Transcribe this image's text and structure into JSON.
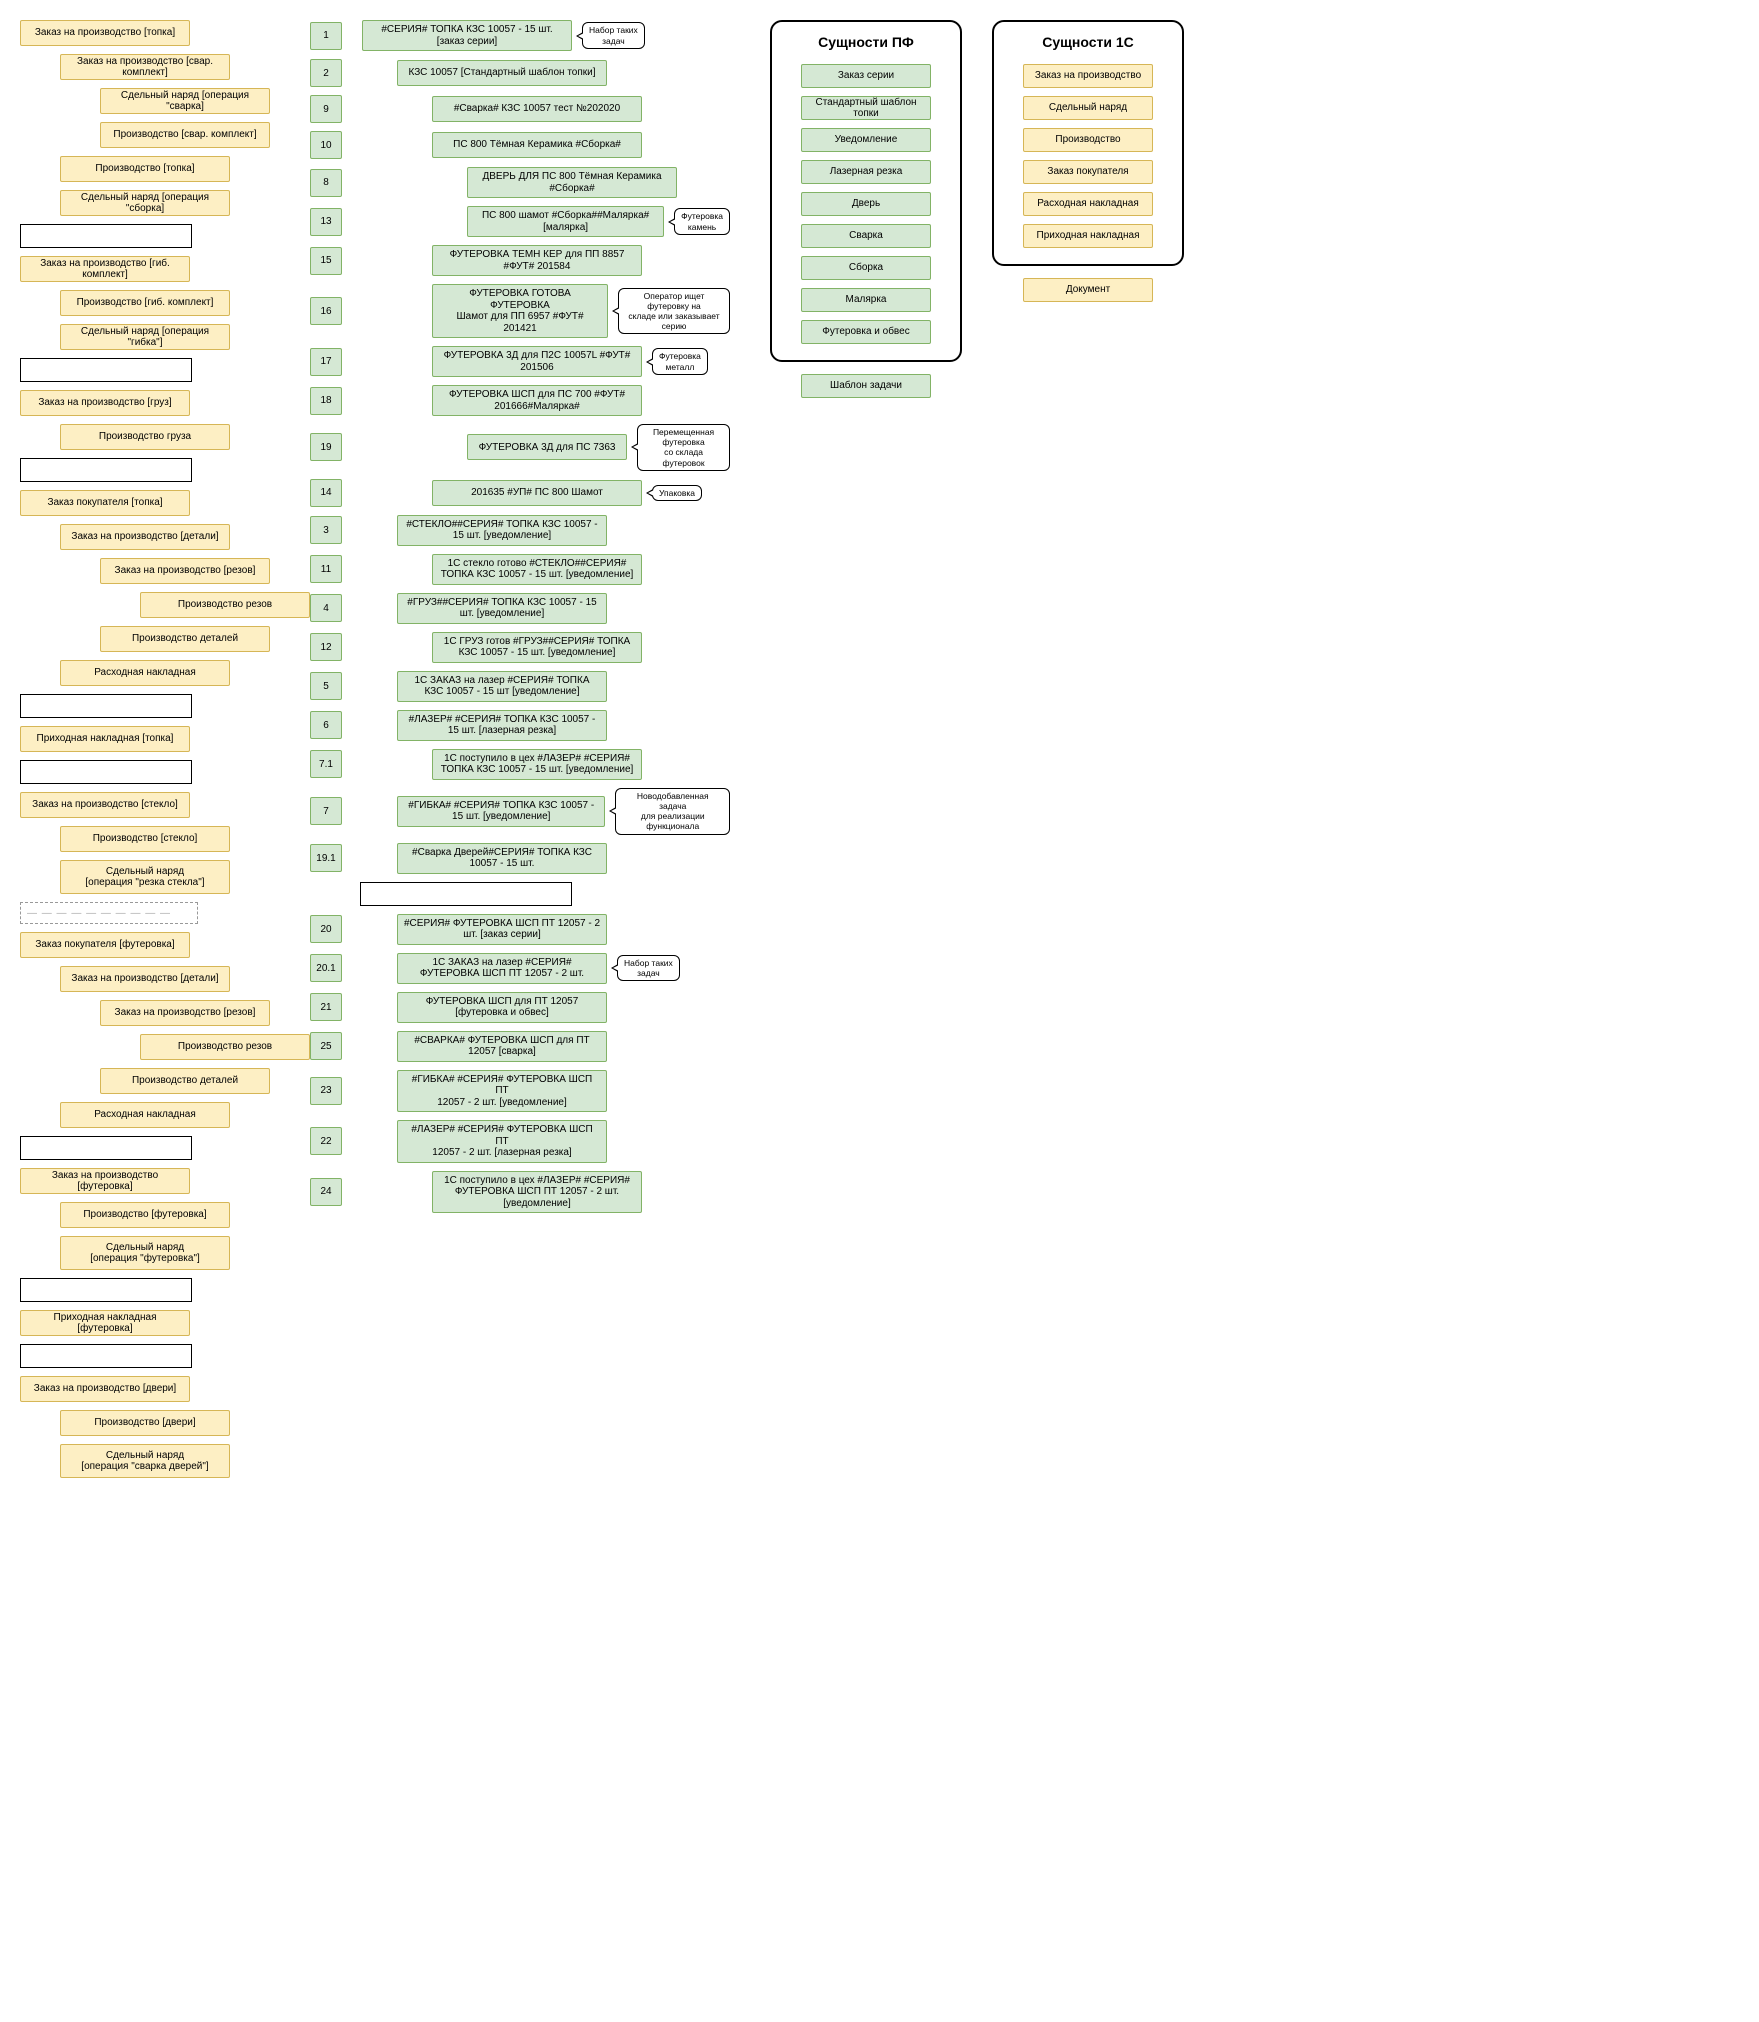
{
  "left_column": [
    {
      "type": "node",
      "style": "yellow",
      "indent": 0,
      "text": "Заказ на производство [топка]"
    },
    {
      "type": "node",
      "style": "yellow",
      "indent": 1,
      "text": "Заказ на производство [свар. комплект]"
    },
    {
      "type": "node",
      "style": "yellow",
      "indent": 2,
      "text": "Сдельный наряд [операция \"сварка]"
    },
    {
      "type": "node",
      "style": "yellow",
      "indent": 2,
      "text": "Производство [свар. комплект]"
    },
    {
      "type": "node",
      "style": "yellow",
      "indent": 1,
      "text": "Производство [топка]"
    },
    {
      "type": "node",
      "style": "yellow",
      "indent": 1,
      "text": "Сдельный наряд [операция \"сборка]"
    },
    {
      "type": "placeholder"
    },
    {
      "type": "node",
      "style": "yellow",
      "indent": 0,
      "text": "Заказ на производство [гиб. комплект]"
    },
    {
      "type": "node",
      "style": "yellow",
      "indent": 1,
      "text": "Производство [гиб. комплект]"
    },
    {
      "type": "node",
      "style": "yellow",
      "indent": 1,
      "text": "Сдельный наряд [операция \"гибка\"]"
    },
    {
      "type": "placeholder"
    },
    {
      "type": "node",
      "style": "yellow",
      "indent": 0,
      "text": "Заказ на производство [груз]"
    },
    {
      "type": "node",
      "style": "yellow",
      "indent": 1,
      "text": "Производство груза"
    },
    {
      "type": "placeholder"
    },
    {
      "type": "node",
      "style": "yellow",
      "indent": 0,
      "text": "Заказ покупателя [топка]"
    },
    {
      "type": "node",
      "style": "yellow",
      "indent": 1,
      "text": "Заказ на производство [детали]"
    },
    {
      "type": "node",
      "style": "yellow",
      "indent": 2,
      "text": "Заказ на производство [резов]"
    },
    {
      "type": "node",
      "style": "yellow",
      "indent": 3,
      "text": "Производство резов"
    },
    {
      "type": "node",
      "style": "yellow",
      "indent": 2,
      "text": "Производство деталей"
    },
    {
      "type": "node",
      "style": "yellow",
      "indent": 1,
      "text": "Расходная накладная"
    },
    {
      "type": "placeholder"
    },
    {
      "type": "node",
      "style": "yellow",
      "indent": 0,
      "text": "Приходная накладная [топка]"
    },
    {
      "type": "placeholder"
    },
    {
      "type": "node",
      "style": "yellow",
      "indent": 0,
      "text": "Заказ на производство [стекло]"
    },
    {
      "type": "node",
      "style": "yellow",
      "indent": 1,
      "text": "Производство [стекло]"
    },
    {
      "type": "node",
      "style": "yellow",
      "indent": 1,
      "tall": true,
      "text": "Сдельный наряд\n[операция \"резка стекла\"]"
    },
    {
      "type": "dashed"
    },
    {
      "type": "node",
      "style": "yellow",
      "indent": 0,
      "text": "Заказ покупателя [футеровка]"
    },
    {
      "type": "node",
      "style": "yellow",
      "indent": 1,
      "text": "Заказ на производство [детали]"
    },
    {
      "type": "node",
      "style": "yellow",
      "indent": 2,
      "text": "Заказ на производство [резов]"
    },
    {
      "type": "node",
      "style": "yellow",
      "indent": 3,
      "text": "Производство резов"
    },
    {
      "type": "node",
      "style": "yellow",
      "indent": 2,
      "text": "Производство деталей"
    },
    {
      "type": "node",
      "style": "yellow",
      "indent": 1,
      "text": "Расходная накладная"
    },
    {
      "type": "placeholder"
    },
    {
      "type": "node",
      "style": "yellow",
      "indent": 0,
      "text": "Заказ на производство [футеровка]"
    },
    {
      "type": "node",
      "style": "yellow",
      "indent": 1,
      "text": "Производство [футеровка]"
    },
    {
      "type": "node",
      "style": "yellow",
      "indent": 1,
      "tall": true,
      "text": "Сдельный наряд\n[операция \"футеровка\"]"
    },
    {
      "type": "placeholder"
    },
    {
      "type": "node",
      "style": "yellow",
      "indent": 0,
      "text": "Приходная накладная [футеровка]"
    },
    {
      "type": "placeholder"
    },
    {
      "type": "node",
      "style": "yellow",
      "indent": 0,
      "text": "Заказ на производство [двери]"
    },
    {
      "type": "node",
      "style": "yellow",
      "indent": 1,
      "text": "Производство [двери]"
    },
    {
      "type": "node",
      "style": "yellow",
      "indent": 1,
      "tall": true,
      "text": "Сдельный наряд\n[операция \"сварка дверей\"]"
    }
  ],
  "mid_column": [
    {
      "num": "1",
      "indent": 0,
      "text": "#СЕРИЯ# ТОПКА КЗС 10057 - 15 шт.\n[заказ серии]",
      "callout": "Набор таких\nзадач"
    },
    {
      "num": "2",
      "indent": 1,
      "text": "КЗС 10057  [Стандартный шаблон топки]"
    },
    {
      "num": "9",
      "indent": 2,
      "text": "#Сварка# КЗС 10057 тест №202020"
    },
    {
      "num": "10",
      "indent": 2,
      "text": "ПС 800 Тёмная Керамика #Сборка#"
    },
    {
      "num": "8",
      "indent": 3,
      "text": "ДВЕРЬ ДЛЯ ПС 800 Тёмная Керамика\n#Сборка#"
    },
    {
      "num": "13",
      "indent": 3,
      "text": "ПС 800 шамот #Сборка##Малярка#\n[малярка]",
      "callout": "Футеровка\nкамень"
    },
    {
      "num": "15",
      "indent": 2,
      "text": "ФУТЕРОВКА  ТЕМН КЕР для ПП 8857\n#ФУТ# 201584"
    },
    {
      "num": "16",
      "indent": 2,
      "text": "ФУТЕРОВКА ГОТОВА ФУТЕРОВКА\nШамот для ПП 6957 #ФУТ# 201421",
      "callout": "Оператор ищет футеровку на\nскладе или заказывает серию"
    },
    {
      "num": "17",
      "indent": 2,
      "text": "ФУТЕРОВКА 3Д для П2С 10057L #ФУТ#\n201506",
      "callout": "Футеровка\nметалл"
    },
    {
      "num": "18",
      "indent": 2,
      "text": "ФУТЕРОВКА ШСП для ПС 700 #ФУТ#\n201666#Малярка#"
    },
    {
      "num": "19",
      "indent": 3,
      "text": "ФУТЕРОВКА 3Д для ПС 7363",
      "callout": "Перемещенная футеровка\nсо склада футеровок"
    },
    {
      "num": "14",
      "indent": 2,
      "text": "201635 #УП# ПС 800 Шамот",
      "callout": "Упаковка"
    },
    {
      "num": "3",
      "indent": 1,
      "text": "#СТЕКЛО##СЕРИЯ# ТОПКА КЗС 10057 -\n15 шт. [уведомление]"
    },
    {
      "num": "11",
      "indent": 2,
      "text": "1С стекло готово #СТЕКЛО##СЕРИЯ#\nТОПКА КЗС 10057 - 15 шт. [уведомление]"
    },
    {
      "num": "4",
      "indent": 1,
      "text": "#ГРУЗ##СЕРИЯ# ТОПКА КЗС 10057 - 15\nшт. [уведомление]"
    },
    {
      "num": "12",
      "indent": 2,
      "text": "1С ГРУЗ готов #ГРУЗ##СЕРИЯ# ТОПКА\nКЗС 10057 - 15 шт. [уведомление]"
    },
    {
      "num": "5",
      "indent": 1,
      "text": "1С ЗАКАЗ на лазер  #СЕРИЯ# ТОПКА\nКЗС 10057 - 15 шт [уведомление]"
    },
    {
      "num": "6",
      "indent": 1,
      "text": "#ЛАЗЕР# #СЕРИЯ# ТОПКА КЗС 10057 -\n15 шт. [лазерная резка]"
    },
    {
      "num": "7.1",
      "indent": 2,
      "text": "1С  поступило в цех  #ЛАЗЕР# #СЕРИЯ#\nТОПКА КЗС 10057 - 15 шт. [уведомление]"
    },
    {
      "num": "7",
      "indent": 1,
      "text": "#ГИБКА# #СЕРИЯ# ТОПКА КЗС 10057 -\n15 шт. [уведомление]",
      "callout": "Новодобавленная задача\nдля реализации\nфункционала"
    },
    {
      "num": "19.1",
      "indent": 1,
      "text": "#Сварка Дверей#СЕРИЯ# ТОПКА КЗС\n10057 - 15 шт."
    },
    {
      "type": "placeholder"
    },
    {
      "num": "20",
      "indent": 1,
      "text": "#СЕРИЯ# ФУТЕРОВКА ШСП ПТ 12057 - 2\nшт. [заказ серии]"
    },
    {
      "num": "20.1",
      "indent": 1,
      "text": "1С ЗАКАЗ на лазер  #СЕРИЯ#\nФУТЕРОВКА ШСП ПТ 12057 - 2 шт.",
      "callout": "Набор таких\nзадач"
    },
    {
      "num": "21",
      "indent": 1,
      "text": "ФУТЕРОВКА ШСП для ПТ 12057\n[футеровка и обвес]"
    },
    {
      "num": "25",
      "indent": 1,
      "text": "#СВАРКА# ФУТЕРОВКА ШСП для ПТ\n12057 [сварка]"
    },
    {
      "num": "23",
      "indent": 1,
      "text": "#ГИБКА# #СЕРИЯ# ФУТЕРОВКА ШСП ПТ\n12057 - 2 шт. [уведомление]"
    },
    {
      "num": "22",
      "indent": 1,
      "text": "#ЛАЗЕР# #СЕРИЯ# ФУТЕРОВКА ШСП ПТ\n12057 - 2 шт. [лазерная резка]"
    },
    {
      "num": "24",
      "indent": 2,
      "text": "1С  поступило в цех  #ЛАЗЕР# #СЕРИЯ#\nФУТЕРОВКА ШСП ПТ 12057 - 2 шт.\n[уведомление]"
    }
  ],
  "panel_pf": {
    "title": "Сущности ПФ",
    "items": [
      "Заказ серии",
      "Стандартный шаблон топки",
      "Уведомление",
      "Лазерная резка",
      "Дверь",
      "Сварка",
      "Сборка",
      "Малярка",
      "Футеровка и обвес"
    ]
  },
  "panel_pf_extra": "Шаблон задачи",
  "panel_1c": {
    "title": "Сущности 1С",
    "items": [
      "Заказ на производство",
      "Сдельный наряд",
      "Производство",
      "Заказ покупателя",
      "Расходная накладная",
      "Приходная накладная"
    ]
  },
  "panel_1c_extra": "Документ"
}
